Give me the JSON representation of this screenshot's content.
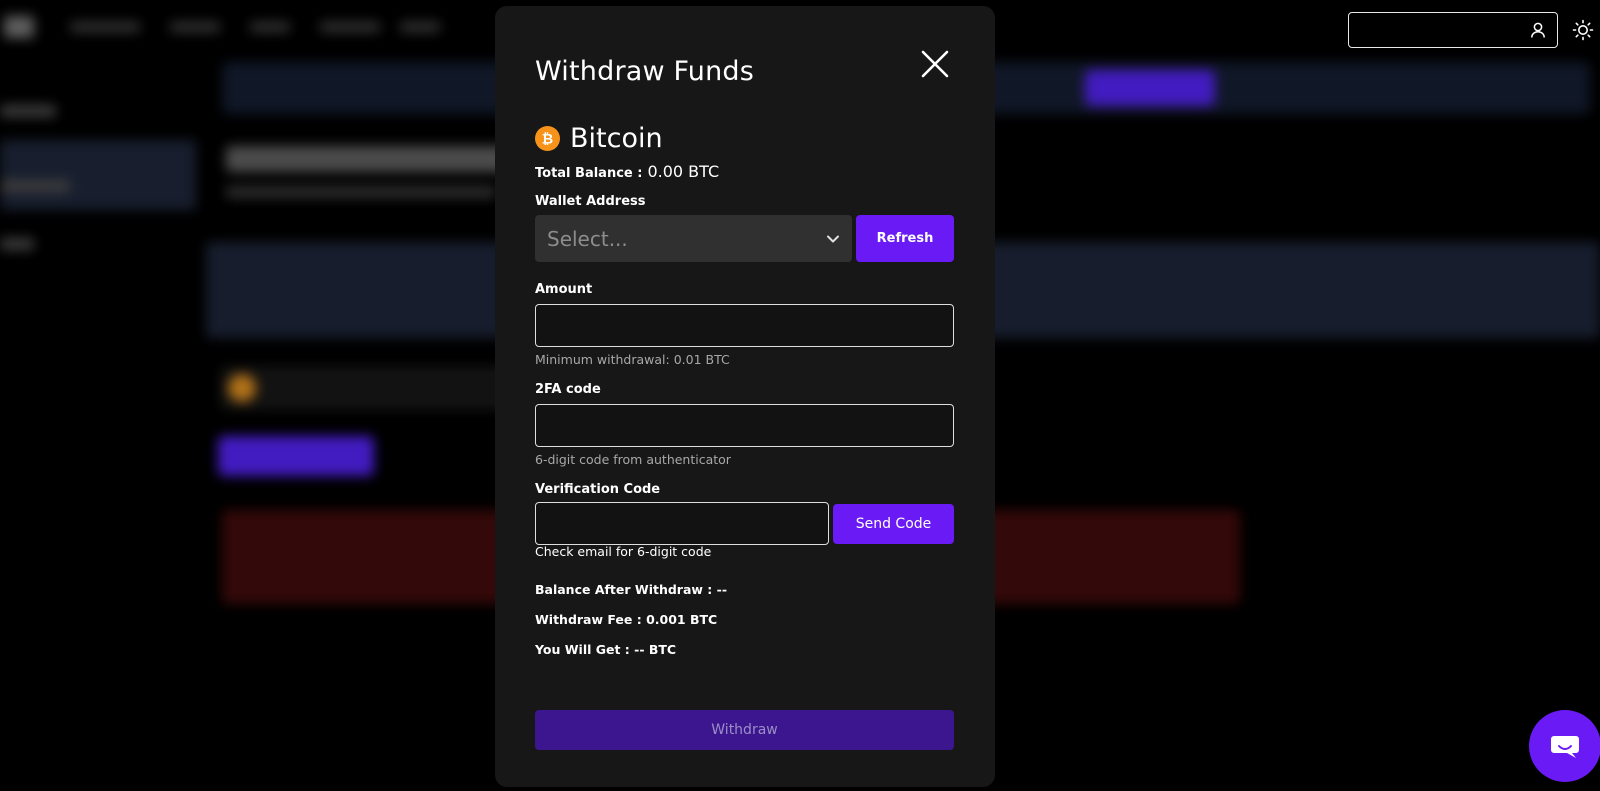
{
  "modal": {
    "title": "Withdraw Funds",
    "coin": {
      "name": "Bitcoin",
      "icon": "bitcoin-icon",
      "icon_color": "#F7931A"
    },
    "balance": {
      "label": "Total Balance :",
      "value": "0.00 BTC"
    },
    "wallet": {
      "label": "Wallet Address",
      "placeholder": "Select...",
      "refresh_label": "Refresh"
    },
    "amount": {
      "label": "Amount",
      "value": "",
      "hint": "Minimum withdrawal: 0.01 BTC"
    },
    "twofa": {
      "label": "2FA code",
      "value": "",
      "hint": "6-digit code from authenticator"
    },
    "verification": {
      "label": "Verification Code",
      "value": "",
      "send_label": "Send Code",
      "hint": "Check email for 6-digit code"
    },
    "summary": {
      "balance_after": "Balance After Withdraw : --",
      "fee": "Withdraw Fee : 0.001 BTC",
      "you_get": "You Will Get : -- BTC"
    },
    "withdraw_label": "Withdraw"
  },
  "colors": {
    "accent": "#6A1BF5",
    "withdraw_disabled": "#3C168F",
    "modal_bg": "#171717",
    "page_bg": "#000000"
  },
  "topbar": {
    "user_icon": "user-icon",
    "theme_icon": "sun-icon"
  },
  "chat": {
    "icon": "chat-bubble-icon"
  }
}
